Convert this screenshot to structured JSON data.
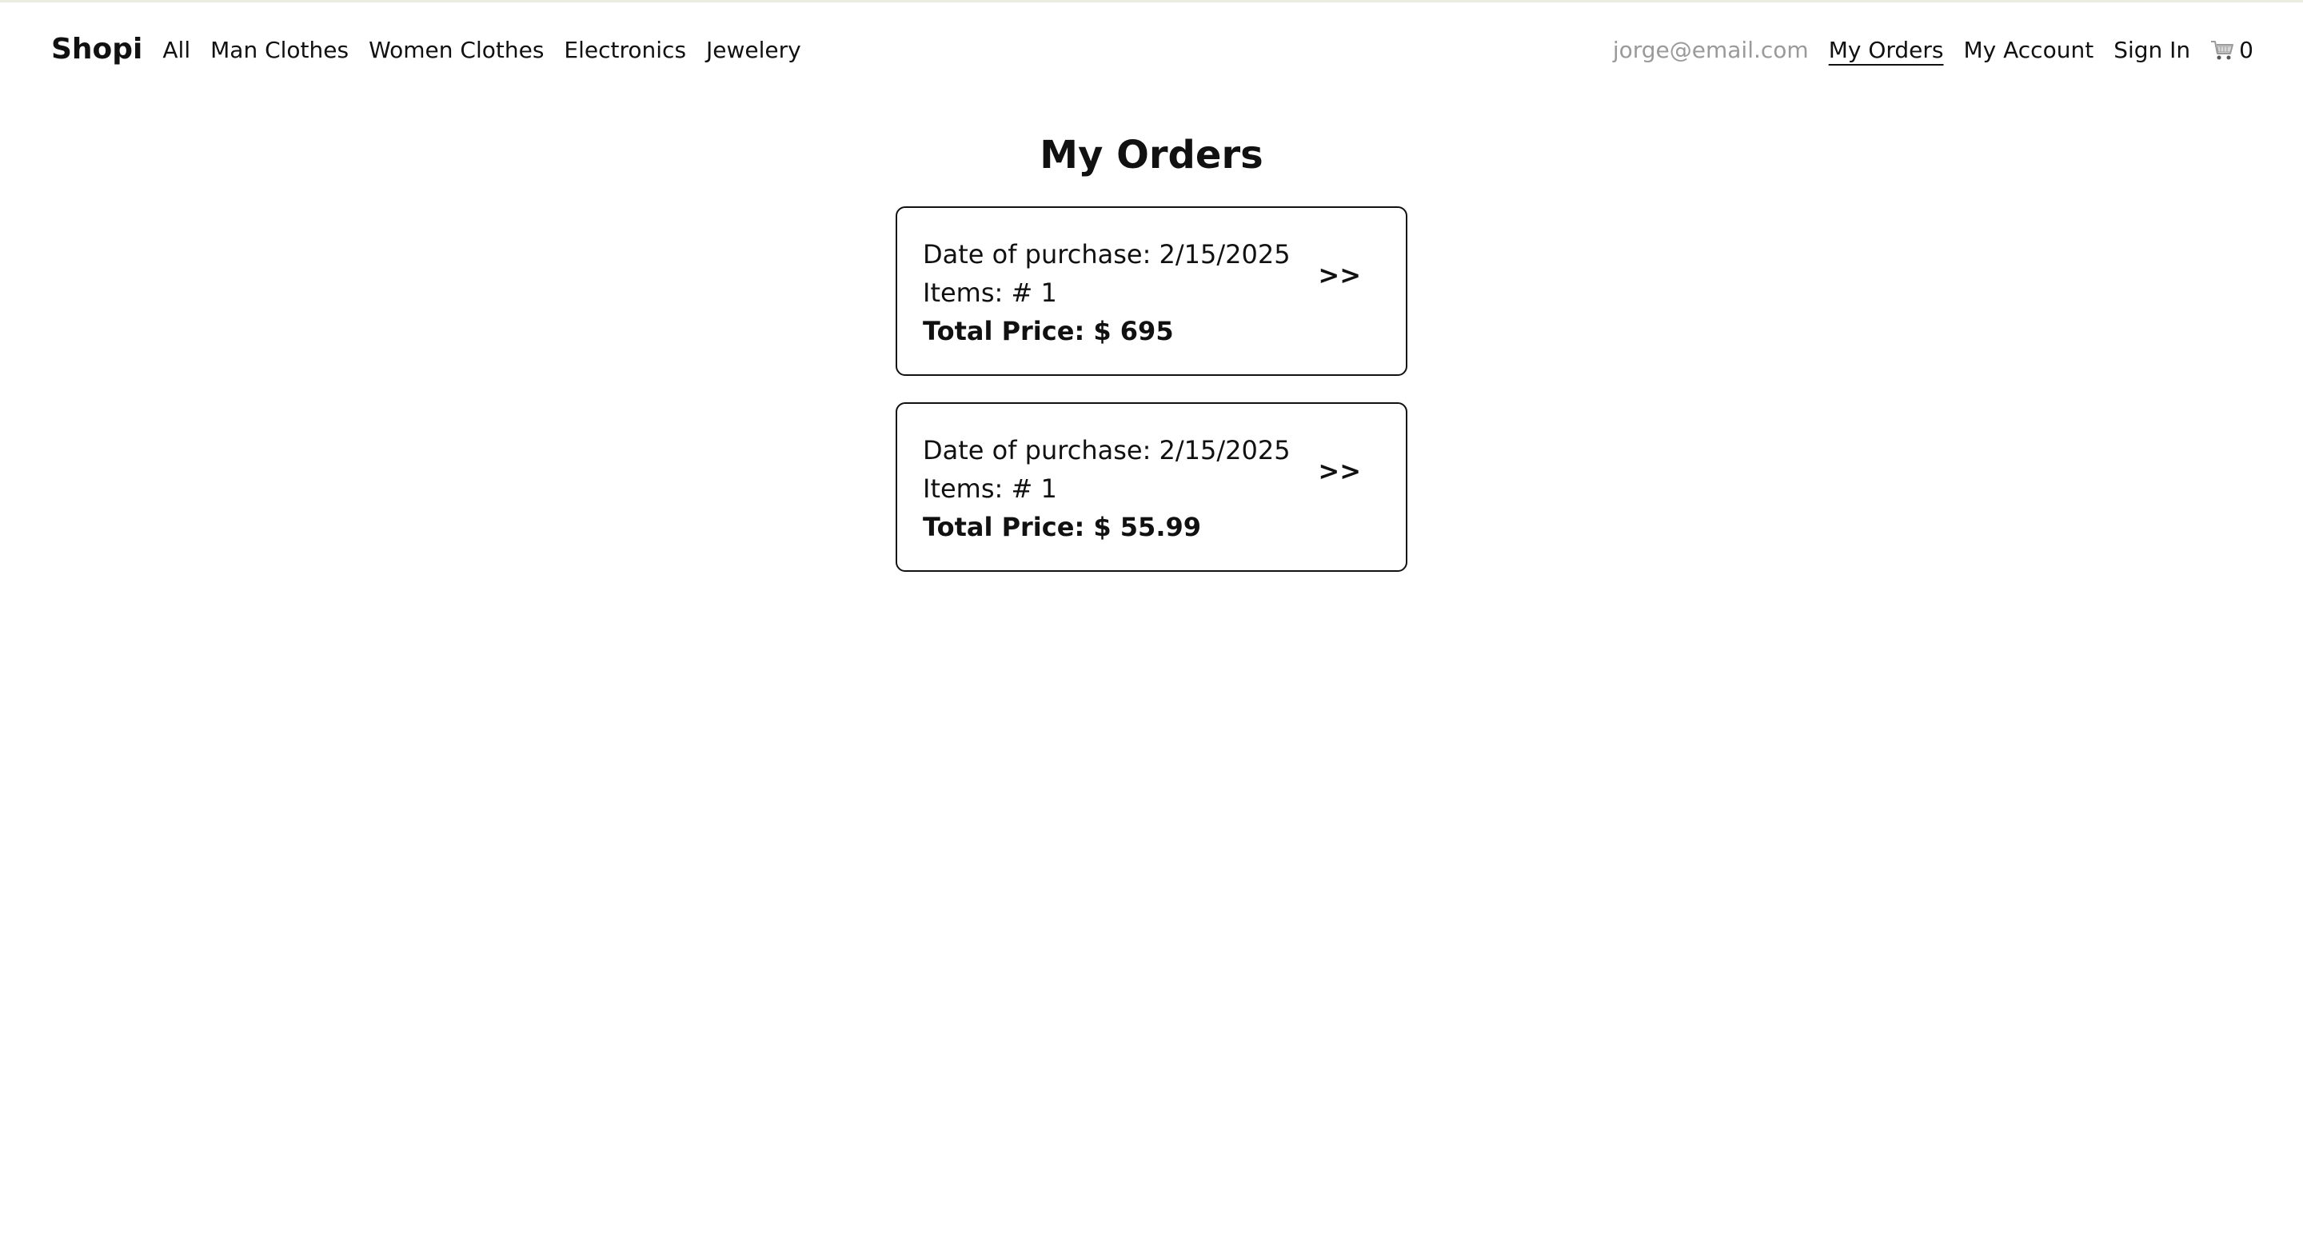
{
  "navbar": {
    "brand": "Shopi",
    "categories": [
      "All",
      "Man Clothes",
      "Women Clothes",
      "Electronics",
      "Jewelery"
    ],
    "email": "jorge@email.com",
    "my_orders": "My Orders",
    "my_account": "My Account",
    "sign_in": "Sign In",
    "cart_icon": "shopping-cart-icon",
    "cart_count": "0"
  },
  "page": {
    "title": "My Orders"
  },
  "orders": [
    {
      "date": "Date of purchase: 2/15/2025",
      "items": "Items: # 1",
      "total": "Total Price: $ 695",
      "arrow": ">>"
    },
    {
      "date": "Date of purchase: 2/15/2025",
      "items": "Items: # 1",
      "total": "Total Price: $ 55.99",
      "arrow": ">>"
    }
  ],
  "colors": {
    "text": "#111111",
    "email": "#9a9a9a",
    "border": "#111111",
    "background": "#ffffff"
  }
}
